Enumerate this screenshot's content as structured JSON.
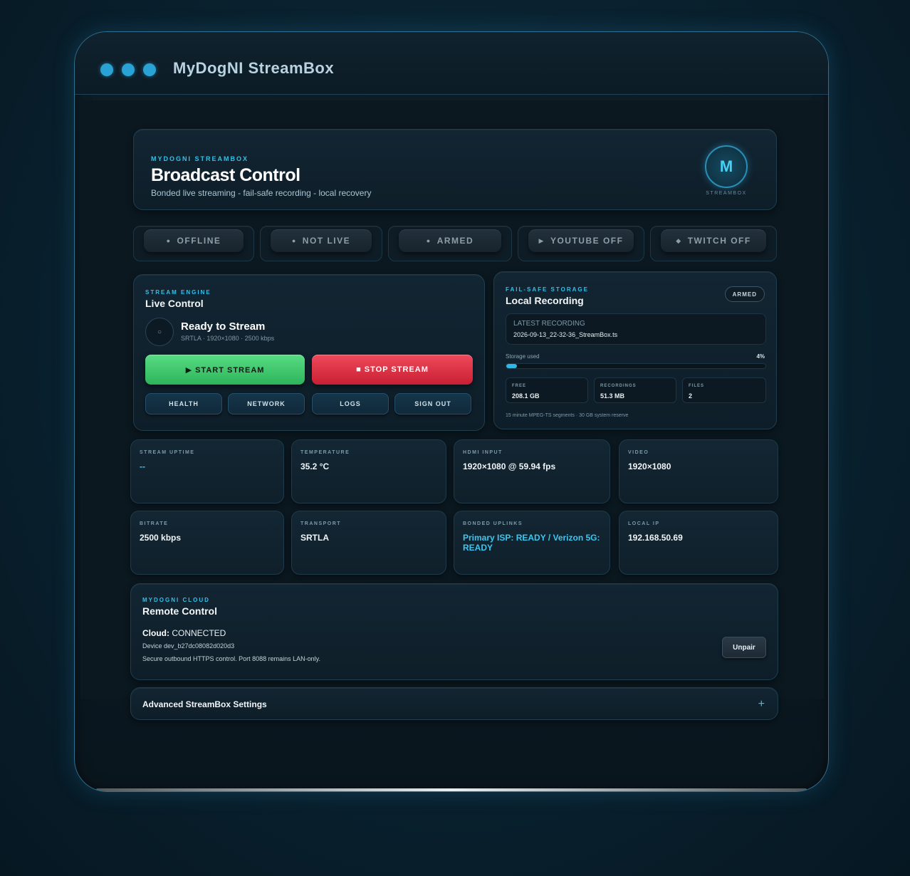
{
  "window": {
    "title": "MyDogNI StreamBox"
  },
  "header": {
    "eyebrow": "MYDOGNI STREAMBOX",
    "title": "Broadcast Control",
    "subtitle": "Bonded live streaming - fail-safe recording - local recovery",
    "logo_letter": "M",
    "logo_caption": "STREAMBOX"
  },
  "status_pills": [
    {
      "icon": "●",
      "label": "OFFLINE"
    },
    {
      "icon": "●",
      "label": "NOT LIVE"
    },
    {
      "icon": "●",
      "label": "ARMED"
    },
    {
      "icon": "▶",
      "label": "YOUTUBE OFF"
    },
    {
      "icon": "◆",
      "label": "TWITCH OFF"
    }
  ],
  "engine": {
    "eyebrow": "STREAM ENGINE",
    "title": "Live Control",
    "ring_icon": "○",
    "ready_title": "Ready to Stream",
    "ready_sub": "SRTLA · 1920×1080 · 2500 kbps",
    "start_label": "▶ START STREAM",
    "stop_label": "■ STOP STREAM",
    "health_label": "HEALTH",
    "network_label": "NETWORK",
    "logs_label": "LOGS",
    "signout_label": "SIGN OUT"
  },
  "storage": {
    "eyebrow": "FAIL-SAFE STORAGE",
    "title": "Local Recording",
    "badge": "ARMED",
    "latest_label": "LATEST RECORDING",
    "latest_value": "2026-09-13_22-32-36_StreamBox.ts",
    "used_label": "Storage used",
    "used_pct_text": "4%",
    "used_fraction": 0.04,
    "free_label": "FREE",
    "free_value": "208.1 GB",
    "recordings_label": "RECORDINGS",
    "recordings_value": "51.3 MB",
    "files_label": "FILES",
    "files_value": "2",
    "footnote": "15 minute MPEG-TS segments · 30 GB system reserve"
  },
  "metrics": {
    "uptime": {
      "label": "STREAM UPTIME",
      "value": "--"
    },
    "temperature": {
      "label": "TEMPERATURE",
      "value": "35.2 °C"
    },
    "hdmi": {
      "label": "HDMI INPUT",
      "value": "1920×1080 @ 59.94 fps"
    },
    "video": {
      "label": "VIDEO",
      "value": "1920×1080"
    },
    "bitrate": {
      "label": "BITRATE",
      "value": "2500 kbps"
    },
    "transport": {
      "label": "TRANSPORT",
      "value": "SRTLA"
    },
    "uplinks": {
      "label": "BONDED UPLINKS",
      "value": "Primary ISP: READY / Verizon 5G: READY"
    },
    "local_ip": {
      "label": "LOCAL IP",
      "value": "192.168.50.69"
    }
  },
  "cloud": {
    "eyebrow": "MYDOGNI CLOUD",
    "title": "Remote Control",
    "status_key": "Cloud:",
    "status_value": " CONNECTED",
    "device": "Device dev_b27dc08082d020d3",
    "note": "Secure outbound HTTPS control. Port 8088 remains LAN-only.",
    "unpair_label": "Unpair"
  },
  "advanced": {
    "title": "Advanced StreamBox Settings",
    "toggle_icon": "+"
  },
  "colors": {
    "accent": "#33c0ea",
    "start": "#2db45a",
    "stop": "#c91f34"
  }
}
